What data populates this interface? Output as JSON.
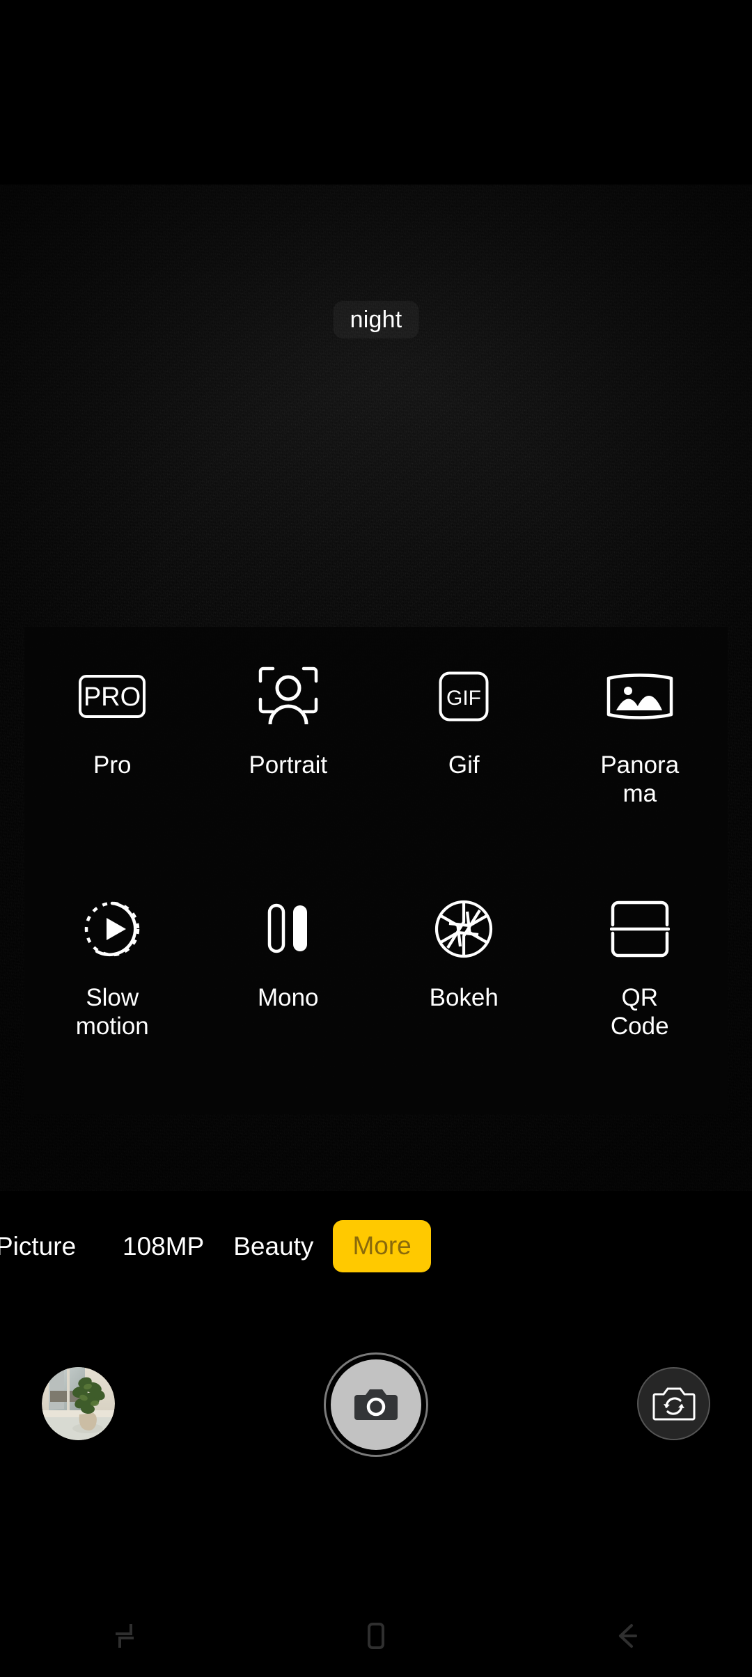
{
  "app": {
    "name": "Camera",
    "background_color": "#000000",
    "accent_color": "#FFC900"
  },
  "preview": {
    "scene_indicator": "night",
    "description": "dark low-light camera preview with visible sensor grain"
  },
  "more_modes_panel": {
    "visible": true,
    "rows": [
      [
        {
          "icon": "pro-badge-icon",
          "label": "Pro"
        },
        {
          "icon": "portrait-person-frame-icon",
          "label": "Portrait"
        },
        {
          "icon": "gif-badge-icon",
          "label": "Gif"
        },
        {
          "icon": "panorama-icon",
          "label": "Panorama"
        }
      ],
      [
        {
          "icon": "slow-motion-play-icon",
          "label": "Slow motion"
        },
        {
          "icon": "mono-bars-icon",
          "label": "Mono"
        },
        {
          "icon": "aperture-icon",
          "label": "Bokeh"
        },
        {
          "icon": "qr-scan-icon",
          "label": "QR Code"
        }
      ]
    ]
  },
  "mode_strip": {
    "items": [
      {
        "label": "Picture",
        "selected": false
      },
      {
        "label": "108MP",
        "selected": false
      },
      {
        "label": "Beauty",
        "selected": false
      },
      {
        "label": "More",
        "selected": true
      }
    ],
    "selected_pill_bg": "#FFC900",
    "selected_pill_text": "#8a6a0b"
  },
  "shutter_bar": {
    "thumbnail_name": "last-photo-thumbnail",
    "thumbnail_description": "potted plant on a windowsill",
    "shutter_icon": "camera-icon",
    "switch_icon": "switch-camera-icon"
  },
  "navbar": {
    "items": [
      {
        "icon": "recents-icon"
      },
      {
        "icon": "home-icon"
      },
      {
        "icon": "back-icon"
      }
    ]
  }
}
